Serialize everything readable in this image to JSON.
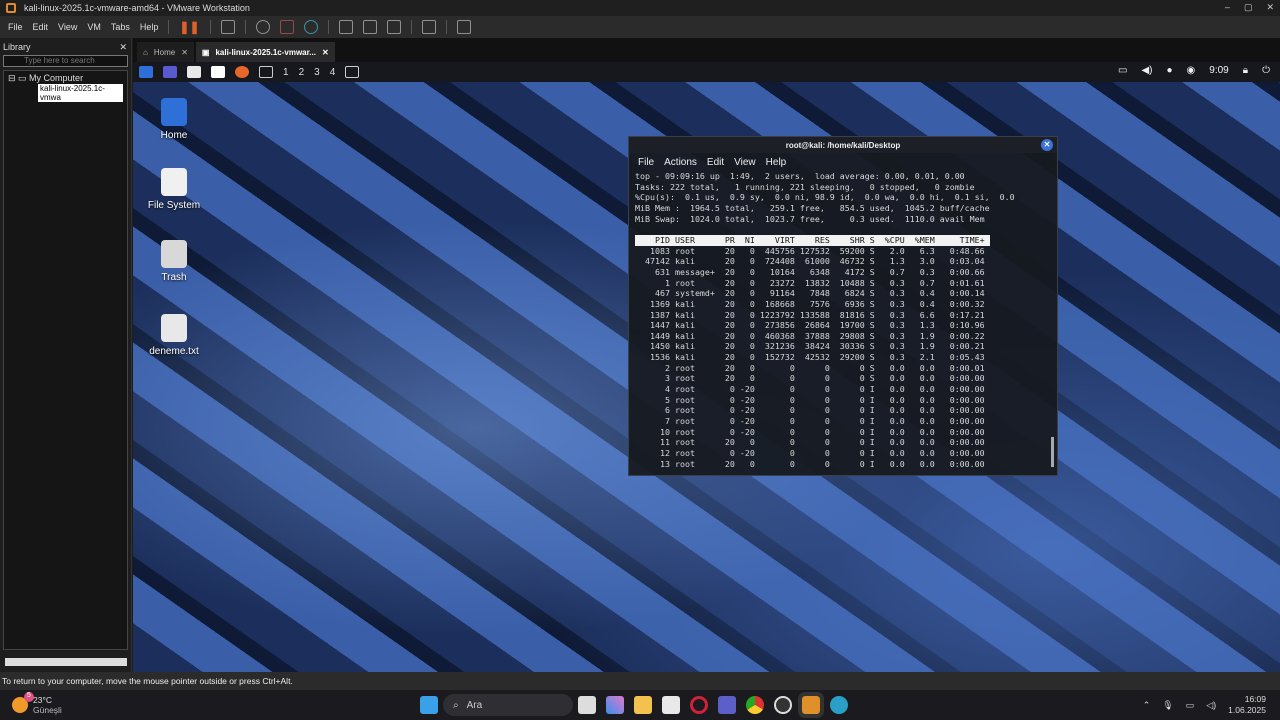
{
  "window": {
    "title": "kali-linux-2025.1c-vmware-amd64 - VMware Workstation",
    "controls": [
      "–",
      "▢",
      "✕"
    ]
  },
  "menu": [
    "File",
    "Edit",
    "View",
    "VM",
    "Tabs",
    "Help"
  ],
  "library": {
    "title": "Library",
    "search_placeholder": "Type here to search",
    "root": "My Computer",
    "vm": "kali-linux-2025.1c-vmwa"
  },
  "tabs": [
    {
      "label": "Home"
    },
    {
      "label": "kali-linux-2025.1c-vmwar..."
    }
  ],
  "kali": {
    "workspaces": [
      "1",
      "2",
      "3",
      "4"
    ],
    "clock": "9:09"
  },
  "desktop": [
    {
      "label": "Home",
      "color": "#2f6fd8"
    },
    {
      "label": "File System",
      "color": "#f0f0f0"
    },
    {
      "label": "Trash",
      "color": "#d8d8d8"
    },
    {
      "label": "deneme.txt",
      "color": "#e8e8e8"
    }
  ],
  "terminal": {
    "title": "root@kali: /home/kali/Desktop",
    "menu": [
      "File",
      "Actions",
      "Edit",
      "View",
      "Help"
    ],
    "summary": [
      "top - 09:09:16 up  1:49,  2 users,  load average: 0.00, 0.01, 0.00",
      "Tasks: 222 total,   1 running, 221 sleeping,   0 stopped,   0 zombie",
      "%Cpu(s):  0.1 us,  0.9 sy,  0.0 ni, 98.9 id,  0.0 wa,  0.0 hi,  0.1 si,  0.0",
      "MiB Mem :  1964.5 total,   259.1 free,   854.5 used,  1045.2 buff/cache",
      "MiB Swap:  1024.0 total,  1023.7 free,     0.3 used.  1110.0 avail Mem",
      ""
    ],
    "header": "    PID USER      PR  NI    VIRT    RES    SHR S  %CPU  %MEM     TIME+ ",
    "rows": [
      "   1083 root      20   0  445756 127532  59200 S   2.0   6.3   0:48.66",
      "  47142 kali      20   0  724408  61000  46732 S   1.3   3.0   0:03.04",
      "    631 message+  20   0   10164   6348   4172 S   0.7   0.3   0:00.66",
      "      1 root      20   0   23272  13832  10488 S   0.3   0.7   0:01.61",
      "    467 systemd+  20   0   91164   7848   6824 S   0.3   0.4   0:00.14",
      "   1369 kali      20   0  168668   7576   6936 S   0.3   0.4   0:00.32",
      "   1387 kali      20   0 1223792 133588  81816 S   0.3   6.6   0:17.21",
      "   1447 kali      20   0  273856  26864  19700 S   0.3   1.3   0:10.96",
      "   1449 kali      20   0  460368  37888  29808 S   0.3   1.9   0:00.22",
      "   1450 kali      20   0  321236  38424  30336 S   0.3   1.9   0:00.21",
      "   1536 kali      20   0  152732  42532  29200 S   0.3   2.1   0:05.43",
      "      2 root      20   0       0      0      0 S   0.0   0.0   0:00.01",
      "      3 root      20   0       0      0      0 S   0.0   0.0   0:00.00",
      "      4 root       0 -20       0      0      0 I   0.0   0.0   0:00.00",
      "      5 root       0 -20       0      0      0 I   0.0   0.0   0:00.00",
      "      6 root       0 -20       0      0      0 I   0.0   0.0   0:00.00",
      "      7 root       0 -20       0      0      0 I   0.0   0.0   0:00.00",
      "     10 root       0 -20       0      0      0 I   0.0   0.0   0:00.00",
      "     11 root      20   0       0      0      0 I   0.0   0.0   0:00.00",
      "     12 root       0 -20       0      0      0 I   0.0   0.0   0:00.00",
      "     13 root      20   0       0      0      0 I   0.0   0.0   0:00.00"
    ]
  },
  "status": "To return to your computer, move the mouse pointer outside or press Ctrl+Alt.",
  "taskbar": {
    "weather_temp": "23°C",
    "weather_desc": "Güneşli",
    "weather_badge": "5",
    "search": "Ara",
    "time": "16:09",
    "date": "1.06.2025",
    "apps": [
      {
        "name": "file-explorer",
        "color": "#f2c14e"
      },
      {
        "name": "store",
        "color": "#e8e8e8"
      },
      {
        "name": "opera",
        "color": "#d0203a"
      },
      {
        "name": "teams",
        "color": "#5b5fc7"
      },
      {
        "name": "chrome",
        "color": "#e0a020"
      },
      {
        "name": "obs",
        "color": "#444"
      },
      {
        "name": "vmware",
        "color": "#e0902a"
      },
      {
        "name": "edge",
        "color": "#2aa0c8"
      }
    ]
  }
}
